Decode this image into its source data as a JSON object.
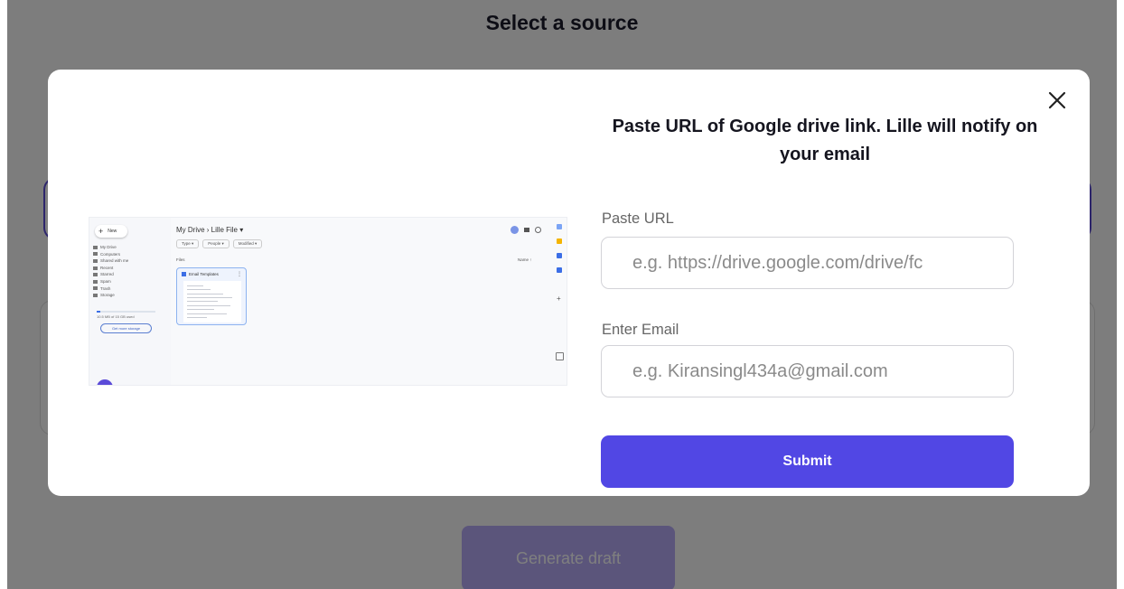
{
  "page": {
    "title": "Select a source",
    "generate_label": "Generate draft"
  },
  "modal": {
    "title": "Paste URL of Google drive link. Lille will notify on your email",
    "url_label": "Paste URL",
    "url_placeholder": "e.g. https://drive.google.com/drive/fc",
    "email_label": "Enter Email",
    "email_placeholder": "e.g. Kiransingl434a@gmail.com",
    "submit_label": "Submit",
    "close_icon": "close-icon"
  },
  "drive_preview": {
    "new_label": "New",
    "breadcrumb": "My Drive  ›  Lille File ▾",
    "filters": [
      "Type ▾",
      "People ▾",
      "Modified ▾"
    ],
    "files_label": "Files",
    "sort_label": "Name ↑",
    "nav_items": [
      "My Drive",
      "Computers",
      "Shared with me",
      "Recent",
      "Starred",
      "Spam",
      "Trash",
      "Storage"
    ],
    "storage_text": "10.5 MB of 15 GB used",
    "get_storage_label": "Get more storage",
    "file_card_title": "Email Templates",
    "rail_colors": [
      "#7ba4f5",
      "#f4b400",
      "#3b6ee6",
      "#3b6ee6"
    ]
  },
  "colors": {
    "accent": "#5147e4",
    "overlay": "rgba(0,0,0,0.5)",
    "disabled_button": "#b7abf6"
  }
}
